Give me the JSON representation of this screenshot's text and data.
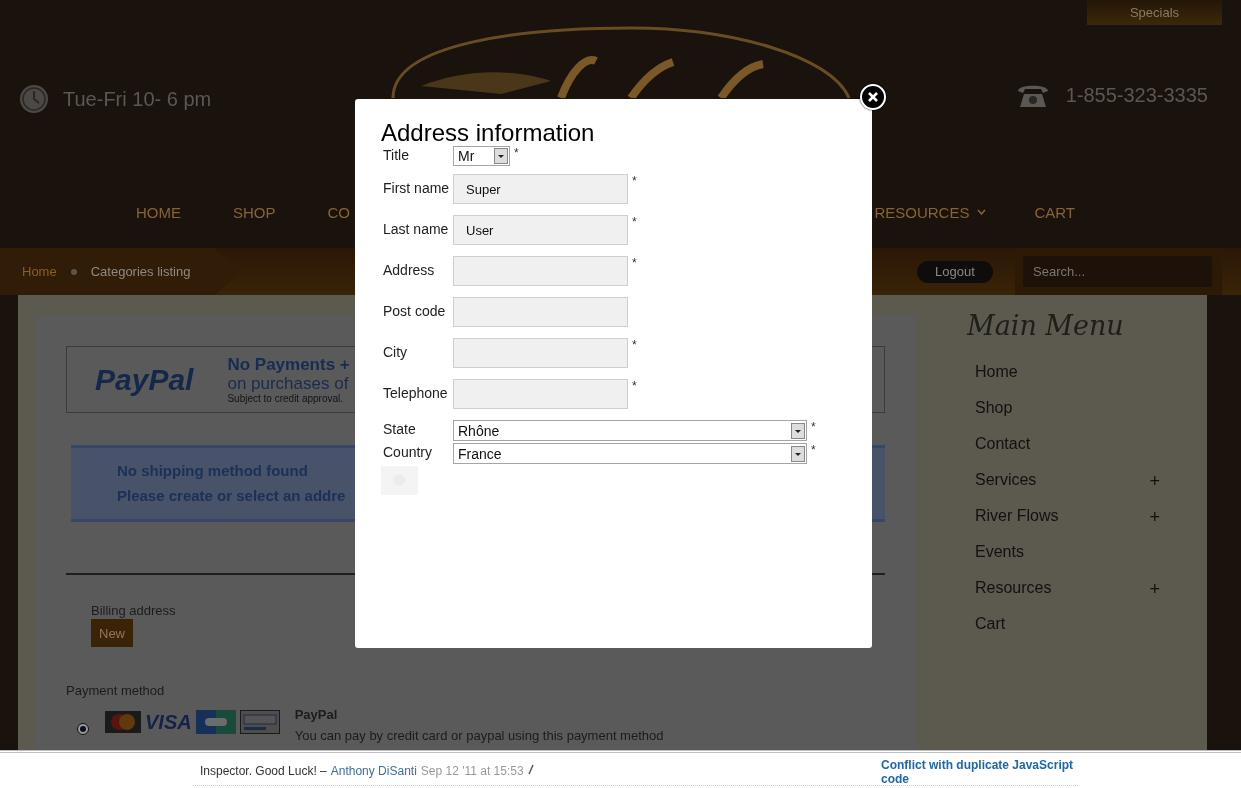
{
  "header": {
    "specials_tab": "Specials",
    "hours": "Tue-Fri 10- 6 pm",
    "phone": "1-855-323-3335"
  },
  "nav": {
    "left": [
      {
        "label": "HOME",
        "dropdown": false
      },
      {
        "label": "SHOP",
        "dropdown": false
      },
      {
        "label": "CO",
        "dropdown": false
      }
    ],
    "right": [
      {
        "label": "RESOURCES",
        "dropdown": true
      },
      {
        "label": "CART",
        "dropdown": false
      }
    ]
  },
  "breadcrumb": [
    {
      "label": "Home",
      "kind": "link"
    },
    {
      "label": "Categories listing",
      "kind": "current"
    }
  ],
  "logout": "Logout",
  "search": {
    "placeholder": "Search..."
  },
  "paypal_banner": {
    "logo": "PayPal",
    "headline": "No Payments +",
    "subline": "on purchases of",
    "fine_print": "Subject to credit approval."
  },
  "notice": [
    "No shipping method found",
    "Please create or select an addre"
  ],
  "billing": {
    "label": "Billing address",
    "button": "New"
  },
  "payment": {
    "label": "Payment method",
    "methods": [
      {
        "name": "PayPal",
        "description": "You can pay by credit card or paypal using this payment method",
        "selected": true,
        "cards": [
          {
            "kind": "mastercard"
          },
          {
            "kind": "visa",
            "label": "VISA"
          },
          {
            "kind": "cb"
          },
          {
            "kind": "paypal"
          }
        ]
      }
    ]
  },
  "sidebar": {
    "title": "Main Menu",
    "items": [
      {
        "label": "Home"
      },
      {
        "label": "Shop"
      },
      {
        "label": "Contact"
      },
      {
        "label": "Services",
        "toggle": "+"
      },
      {
        "label": "River Flows",
        "toggle": "+"
      },
      {
        "label": "Events"
      },
      {
        "label": "Resources",
        "toggle": "+"
      },
      {
        "label": "Cart"
      }
    ]
  },
  "modal": {
    "title": "Address information",
    "fields": [
      {
        "kind": "short_select",
        "label": "Title",
        "value": "Mr",
        "marker": "*"
      },
      {
        "kind": "text",
        "label": "First name",
        "value": "Super",
        "marker": "*"
      },
      {
        "kind": "text",
        "label": "Last name",
        "value": "User",
        "marker": "*"
      },
      {
        "kind": "text",
        "label": "Address",
        "marker": "*"
      },
      {
        "kind": "text",
        "label": "Post code"
      },
      {
        "kind": "text",
        "label": "City",
        "marker": "*"
      },
      {
        "kind": "text",
        "label": "Telephone",
        "marker": "*"
      },
      {
        "kind": "wide_select",
        "label": "State",
        "value": "Rhône",
        "marker": "*"
      },
      {
        "kind": "wide_select",
        "label": "Country",
        "value": "France",
        "marker": "*"
      }
    ]
  },
  "footer": {
    "comment": "Inspector. Good Luck! –",
    "author": "Anthony DiSanti",
    "time": "Sep 12 '11 at 15:53",
    "related_link": "Conflict with duplicate JavaScript code"
  }
}
